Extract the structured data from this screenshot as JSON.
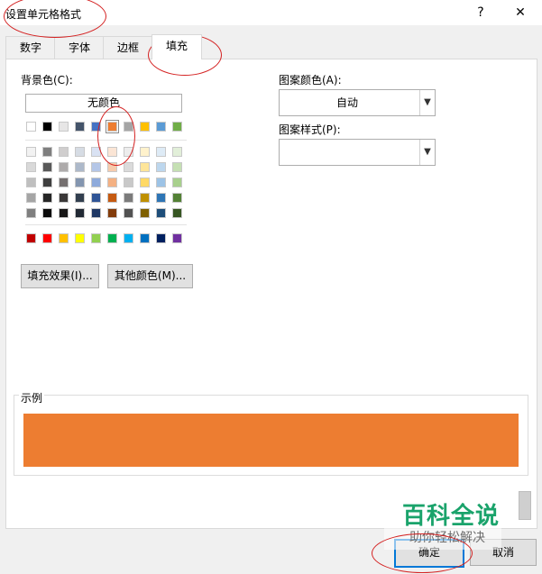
{
  "dialog": {
    "title": "设置单元格格式",
    "help_glyph": "?",
    "close_glyph": "✕"
  },
  "tabs": [
    {
      "label": "数字"
    },
    {
      "label": "字体"
    },
    {
      "label": "边框"
    },
    {
      "label": "填充",
      "active": true
    }
  ],
  "background": {
    "label": "背景色(C):",
    "no_color": "无颜色",
    "selected_color": "#ed7d31",
    "theme_row": [
      "#ffffff",
      "#000000",
      "#e7e6e6",
      "#44546a",
      "#4472c4",
      "#ed7d31",
      "#a5a5a5",
      "#ffc000",
      "#5b9bd5",
      "#70ad47"
    ],
    "tint_rows": [
      [
        "#f2f2f2",
        "#7f7f7f",
        "#d0cece",
        "#d6dce4",
        "#d9e2f3",
        "#fbe5d5",
        "#ededed",
        "#fff2cc",
        "#deebf6",
        "#e2efd9"
      ],
      [
        "#d9d9d9",
        "#595959",
        "#aeabab",
        "#adb9ca",
        "#b4c6e7",
        "#f7cbac",
        "#dbdbdb",
        "#fee599",
        "#bdd7ee",
        "#c5e0b3"
      ],
      [
        "#bfbfbf",
        "#3f3f3f",
        "#757070",
        "#8496b0",
        "#8eaadb",
        "#f4b183",
        "#c9c9c9",
        "#ffd965",
        "#9dc3e6",
        "#a8d08d"
      ],
      [
        "#a5a5a5",
        "#262626",
        "#3a3838",
        "#323f4f",
        "#2f5496",
        "#c55a11",
        "#7b7b7b",
        "#bf9000",
        "#2e75b5",
        "#538135"
      ],
      [
        "#7f7f7f",
        "#0c0c0c",
        "#171616",
        "#222a35",
        "#1f3864",
        "#833c0b",
        "#525252",
        "#7f6000",
        "#1e4e79",
        "#375623"
      ]
    ],
    "standard_row": [
      "#c00000",
      "#ff0000",
      "#ffc000",
      "#ffff00",
      "#92d050",
      "#00b050",
      "#00b0f0",
      "#0070c0",
      "#002060",
      "#7030a0"
    ],
    "fill_effects_button": "填充效果(I)...",
    "more_colors_button": "其他颜色(M)..."
  },
  "pattern": {
    "color_label": "图案颜色(A):",
    "color_value": "自动",
    "style_label": "图案样式(P):",
    "style_value": ""
  },
  "sample": {
    "label": "示例",
    "color": "#ed7d31"
  },
  "footer": {
    "ok_label": "确定",
    "cancel_label": "取消"
  },
  "watermark": {
    "title": "百科全说",
    "subtitle": "助你轻松解决"
  }
}
